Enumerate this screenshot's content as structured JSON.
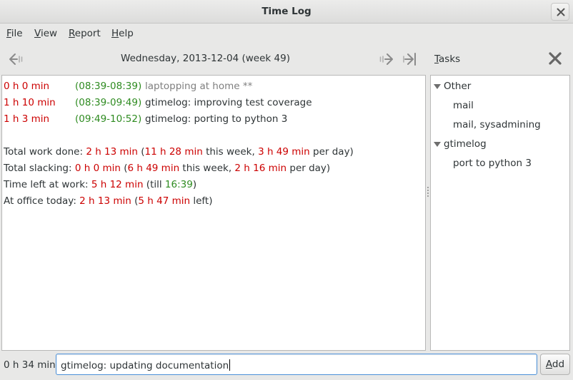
{
  "window": {
    "title": "Time Log"
  },
  "menu": {
    "file": "File",
    "view": "View",
    "report": "Report",
    "help": "Help"
  },
  "toolbar": {
    "date": "Wednesday, 2013-12-04 (week 49)",
    "tasks_label": "Tasks",
    "icons": [
      "go-back-icon",
      "go-forward-icon",
      "go-to-today-icon",
      "close-tasks-icon"
    ]
  },
  "log": {
    "entries": [
      {
        "duration": "0 h 0 min",
        "range": "(08:39-08:39)",
        "task": "laptopping at home **",
        "slacking": true
      },
      {
        "duration": "1 h 10 min",
        "range": "(08:39-09:49)",
        "task": "gtimelog: improving test coverage",
        "slacking": false
      },
      {
        "duration": "1 h 3 min",
        "range": "(09:49-10:52)",
        "task": "gtimelog: porting to python 3",
        "slacking": false
      }
    ],
    "totals": {
      "work": {
        "label": "Total work done: ",
        "value": "2 h 13 min",
        "open": " (",
        "week": "11 h 28 min",
        "week_suffix": " this week, ",
        "per_day": "3 h 49 min",
        "per_day_suffix": " per day)"
      },
      "slacking": {
        "label": "Total slacking: ",
        "value": "0 h 0 min",
        "open": " (",
        "week": "6 h 49 min",
        "week_suffix": " this week, ",
        "per_day": "2 h 16 min",
        "per_day_suffix": " per day)"
      },
      "time_left": {
        "label": "Time left at work: ",
        "value": "5 h 12 min",
        "till_prefix": " (till ",
        "till": "16:39",
        "close": ")"
      },
      "at_office": {
        "label": "At office today: ",
        "value": "2 h 13 min",
        "open": " (",
        "left": "5 h 47 min",
        "left_suffix": " left)"
      }
    }
  },
  "tasks": {
    "groups": [
      {
        "name": "Other",
        "items": [
          "mail",
          "mail, sysadmining"
        ]
      },
      {
        "name": "gtimelog",
        "items": [
          "port to python 3"
        ]
      }
    ]
  },
  "bottom": {
    "elapsed": "0 h 34 min",
    "entry_value": "gtimelog: updating documentation",
    "add_label": "Add"
  },
  "colors": {
    "duration": "#cc0000",
    "time_range": "#2e8b20",
    "slacking_text": "#7f7f7f",
    "entry_focus": "#4a90d9"
  }
}
